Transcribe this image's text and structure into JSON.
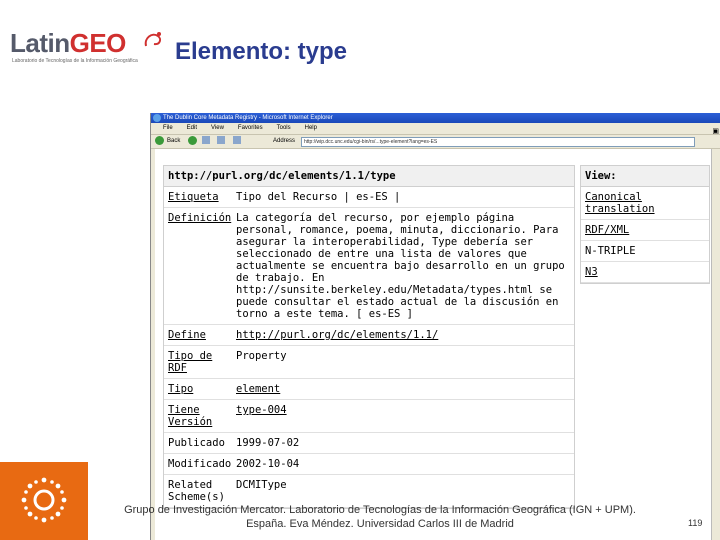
{
  "logo": {
    "brand_a": "Latin",
    "brand_b": "GEO",
    "subtitle": "Laboratorio de Tecnologías de la Información Geográfica"
  },
  "slide": {
    "title": "Elemento: type"
  },
  "browser": {
    "window_title": "The Dublin Core Metadata Registry - Microsoft Internet Explorer",
    "menu": [
      "File",
      "Edit",
      "View",
      "Favorites",
      "Tools",
      "Help"
    ],
    "back_label": "Back",
    "address_label": "Address",
    "address_value": "http://wip.dcc.unc.edu/cgi-bin/rs/...type-element?lang=es-ES"
  },
  "doc": {
    "header": "http://purl.org/dc/elements/1.1/type",
    "rows": [
      {
        "key": "Etiqueta",
        "value": "Tipo del Recurso | es-ES |"
      },
      {
        "key": "Definición",
        "value": "La categoría del recurso, por ejemplo página personal, romance, poema, minuta, diccionario. Para asegurar la interoperabilidad, Type debería ser seleccionado de entre una lista de valores que actualmente se encuentra bajo desarrollo en un grupo de trabajo. En http://sunsite.berkeley.edu/Metadata/types.html se puede consultar el estado actual de la discusión en torno a este tema. [ es-ES ]"
      },
      {
        "key": "Define",
        "value": "http://purl.org/dc/elements/1.1/"
      },
      {
        "key": "Tipo de RDF",
        "value": "Property"
      },
      {
        "key": "Tipo",
        "value": "element"
      },
      {
        "key": "Tiene Versión",
        "value": "type-004"
      },
      {
        "key": "Publicado",
        "value": "1999-07-02"
      },
      {
        "key": "Modificado",
        "value": "2002-10-04"
      },
      {
        "key": "Related Scheme(s)",
        "value": "DCMIType"
      }
    ]
  },
  "view": {
    "header": "View:",
    "items": [
      "Canonical translation",
      "RDF/XML",
      "N-TRIPLE",
      "N3"
    ]
  },
  "footer": {
    "line1": "Grupo de Investigación Mercator. Laboratorio de Tecnologías de la Información Geográfica (IGN + UPM).",
    "line2": "España. Eva Méndez. Universidad Carlos III de Madrid",
    "page": "119"
  },
  "colors": {
    "title": "#2a3c8f",
    "accent_orange": "#e86a12",
    "logo_red": "#d0302f"
  }
}
